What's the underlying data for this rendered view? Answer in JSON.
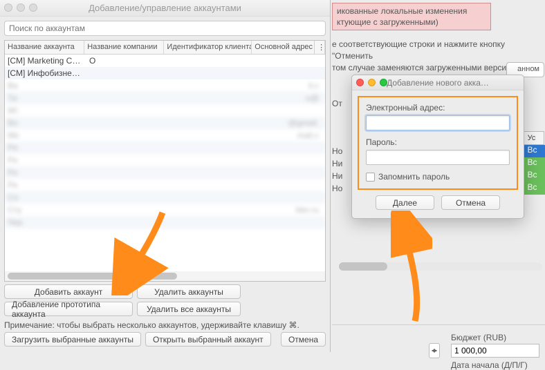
{
  "bg": {
    "banner_line1": "икованные локальные изменения",
    "banner_line2": "ктующие с загруженными)",
    "note_line1": "е соответствующие строки и нажмите кнопку \"Отменить",
    "note_line2": "том случае заменяются загруженными версиями.",
    "tab_fragment": "анном",
    "ot_fragment": "От",
    "col_head": "Ус",
    "pill_labels": [
      "Вс",
      "Вс",
      "Вс",
      "Вс"
    ],
    "row_prefix": [
      "Но",
      "Ни",
      "Ни",
      "Но"
    ],
    "pill_colors": [
      "#2f78d1",
      "#6bbf5c",
      "#6bbf5c",
      "#6bbf5c"
    ],
    "budget_label": "Бюджет (RUB)",
    "budget_value": "1 000,00",
    "date_label": "Дата начала (Д/П/Г)"
  },
  "main": {
    "title": "Добавление/управление аккаунтами",
    "search_placeholder": "Поиск по аккаунтам",
    "columns": [
      "Название аккаунта",
      "Название компании",
      "Идентификатор клиента",
      "Основной адрес"
    ],
    "corner_glyph": "⋮≡",
    "rows": [
      {
        "name": "[CM] Marketing Co…",
        "company": "O",
        "addr": ""
      },
      {
        "name": "[CM] Инфобизнес…",
        "company": "",
        "addr": ""
      },
      {
        "name": "Ba",
        "company": "",
        "addr": "il.c"
      },
      {
        "name": "Та",
        "company": "",
        "addr": "u@"
      },
      {
        "name": "W\\",
        "company": "",
        "addr": ""
      },
      {
        "name": "Bo",
        "company": "",
        "addr": "@gmail."
      },
      {
        "name": "Me",
        "company": "",
        "addr": "mail.c"
      },
      {
        "name": "Pe",
        "company": "",
        "addr": ""
      },
      {
        "name": "Pe",
        "company": "",
        "addr": ""
      },
      {
        "name": "Pe",
        "company": "",
        "addr": ""
      },
      {
        "name": "Pe",
        "company": "",
        "addr": ""
      },
      {
        "name": "Co",
        "company": "",
        "addr": ""
      },
      {
        "name": "Сту",
        "company": "",
        "addr": "bler.ru"
      },
      {
        "name": "Чер",
        "company": "",
        "addr": ""
      }
    ],
    "btn_add_account": "Добавить аккаунт",
    "btn_delete_accounts": "Удалить аккаунты",
    "btn_add_prototype": "Добавление прототипа аккаунта",
    "btn_delete_all": "Удалить все аккаунты",
    "note": "Примечание: чтобы выбрать несколько аккаунтов, удерживайте клавишу ⌘.",
    "btn_load_selected": "Загрузить выбранные аккаунты",
    "btn_open_selected": "Открыть выбранный аккаунт",
    "btn_cancel": "Отмена"
  },
  "addModal": {
    "title": "Добавление нового акка…",
    "email_label": "Электронный адрес:",
    "password_label": "Пароль:",
    "remember_label": "Запомнить пароль",
    "btn_next": "Далее",
    "btn_cancel": "Отмена"
  },
  "colors": {
    "arrow": "#ff8c1a"
  }
}
